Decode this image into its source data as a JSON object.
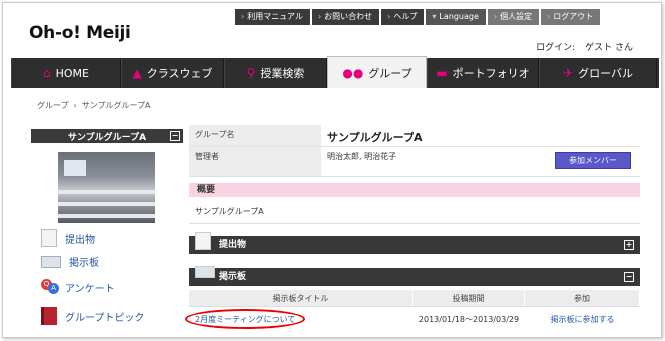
{
  "utility_menu": [
    {
      "label": "利用マニュアル",
      "style": "dark"
    },
    {
      "label": "お問い合わせ",
      "style": "dark"
    },
    {
      "label": "ヘルプ",
      "style": "dark"
    },
    {
      "label": "Language",
      "style": "lang"
    },
    {
      "label": "個人設定",
      "style": "gray"
    },
    {
      "label": "ログアウト",
      "style": "gray"
    }
  ],
  "logo": "Oh-o! Meiji",
  "login": {
    "prefix": "ログイン:",
    "user": "ゲスト さん"
  },
  "nav": [
    {
      "label": "HOME",
      "icon": "home-icon",
      "glyph": "⌂",
      "width": 110
    },
    {
      "label": "クラスウェブ",
      "icon": "mortarboard-icon",
      "glyph": "🎓",
      "width": 103
    },
    {
      "label": "授業検索",
      "icon": "search-icon",
      "glyph": "🔍",
      "width": 103
    },
    {
      "label": "グループ",
      "icon": "group-icon",
      "glyph": "👥",
      "width": 100,
      "active": true
    },
    {
      "label": "ポートフォリオ",
      "icon": "folder-icon",
      "glyph": "▬",
      "width": 112
    },
    {
      "label": "グローバル",
      "icon": "airplane-icon",
      "glyph": "✈",
      "width": 118
    }
  ],
  "breadcrumb": {
    "parent": "グループ",
    "separator": "›",
    "current": "サンプルグループA"
  },
  "sidebar": {
    "title": "サンプルグループA",
    "links": [
      {
        "label": "提出物",
        "icon": "document-icon"
      },
      {
        "label": "掲示板",
        "icon": "bulletin-board-icon"
      },
      {
        "label": "アンケート",
        "icon": "survey-icon"
      },
      {
        "label": "グループトピック",
        "icon": "notebook-icon"
      }
    ]
  },
  "group_info": {
    "name_label": "グループ名",
    "name_value": "サンプルグループA",
    "admin_label": "管理者",
    "admin_value": "明治太郎, 明治花子",
    "join_button": "参加メンバー"
  },
  "overview": {
    "title": "概要",
    "text": "サンプルグループA"
  },
  "submissions": {
    "title": "提出物"
  },
  "board": {
    "title": "掲示板",
    "columns": [
      "掲示板タイトル",
      "投稿期間",
      "参加"
    ],
    "rows": [
      {
        "title": "2月度ミーティングについて",
        "period": "2013/01/18〜2013/03/29",
        "action": "掲示板に参加する"
      }
    ]
  },
  "colors": {
    "accent_pink": "#e6007e",
    "join_button": "#5a58c8",
    "highlight_red": "#e00000"
  }
}
